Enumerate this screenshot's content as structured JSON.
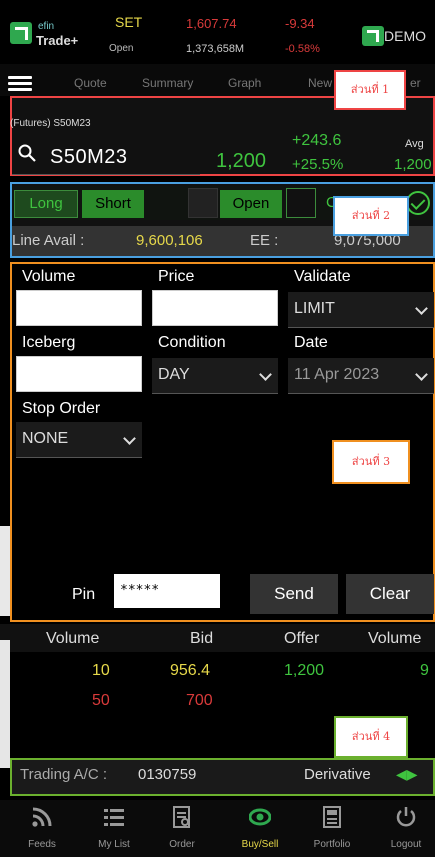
{
  "header": {
    "app_name_small": "efin",
    "app_name": "Trade+",
    "market": "SET",
    "market_status": "Open",
    "index_value": "1,607.74",
    "index_volume": "1,373,658M",
    "index_change": "-9.34",
    "index_change_pct": "-0.58%",
    "mode": "DEMO"
  },
  "nav": {
    "tabs": [
      "Quote",
      "Summary",
      "Graph",
      "New",
      "er"
    ]
  },
  "notes": {
    "part1": "ส่วนที่ 1",
    "part2": "ส่วนที่ 2",
    "part3": "ส่วนที่ 3",
    "part4": "ส่วนที่ 4"
  },
  "quote": {
    "instrument_label": "(Futures) S50M23",
    "symbol": "S50M23",
    "last_price": "1,200",
    "change": "+243.6",
    "change_pct": "+25.5%",
    "avg_label": "Avg",
    "avg_value": "1,200"
  },
  "side": {
    "long": "Long",
    "short": "Short",
    "open": "Open",
    "close": "Cl",
    "line_avail_label": "Line Avail :",
    "line_avail_value": "9,600,106",
    "ee_label": "EE :",
    "ee_value": "9,075,000"
  },
  "order_form": {
    "volume_label": "Volume",
    "price_label": "Price",
    "validate_label": "Validate",
    "validate_value": "LIMIT",
    "iceberg_label": "Iceberg",
    "condition_label": "Condition",
    "condition_value": "DAY",
    "date_label": "Date",
    "date_value": "11 Apr 2023",
    "stop_order_label": "Stop Order",
    "stop_order_value": "NONE",
    "pin_label": "Pin",
    "pin_value": "*****",
    "send_label": "Send",
    "clear_label": "Clear"
  },
  "book": {
    "headers": [
      "Volume",
      "Bid",
      "Offer",
      "Volume"
    ],
    "rows": [
      {
        "bid_volume": "10",
        "bid": "956.4",
        "offer": "1,200",
        "offer_volume": "9"
      },
      {
        "bid_volume": "50",
        "bid": "700",
        "offer": "",
        "offer_volume": ""
      }
    ]
  },
  "account": {
    "label": "Trading A/C :",
    "number": "0130759",
    "type": "Derivative",
    "arrows": "◀▶"
  },
  "bottom_nav": {
    "items": [
      "Feeds",
      "My List",
      "Order",
      "Buy/Sell",
      "Portfolio",
      "Logout"
    ],
    "active": "Buy/Sell"
  },
  "colors": {
    "up": "#3fc43f",
    "down": "#d83a3a",
    "accent": "#e6d84a"
  }
}
